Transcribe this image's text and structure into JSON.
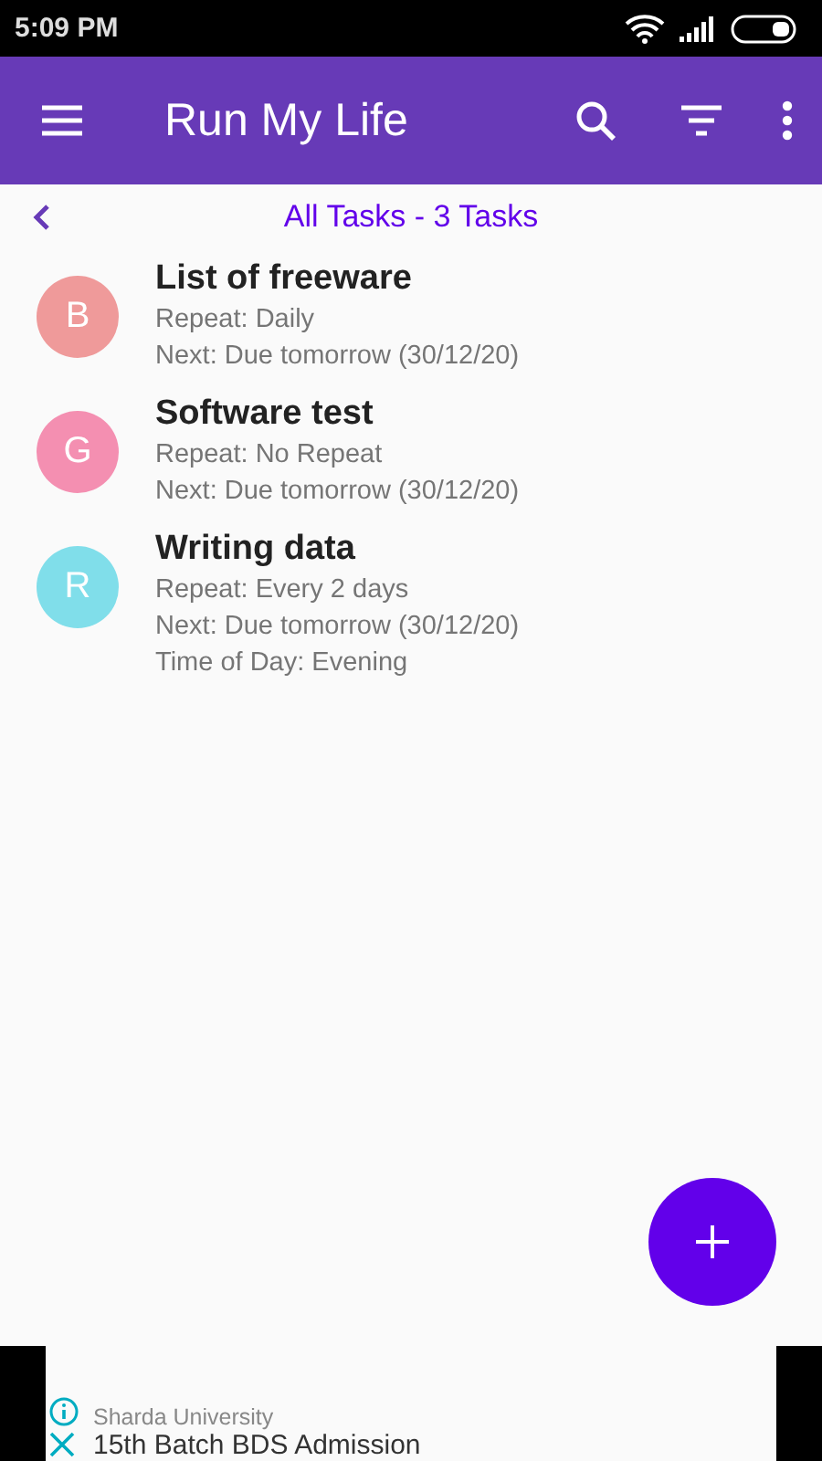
{
  "status_bar": {
    "time": "5:09 PM"
  },
  "app_bar": {
    "title": "Run My Life"
  },
  "header": {
    "title": "All Tasks - 3 Tasks"
  },
  "tasks": [
    {
      "initial": "B",
      "color": "#ef9a9a",
      "title": "List of freeware",
      "details": [
        "Repeat: Daily",
        "Next: Due tomorrow (30/12/20)"
      ]
    },
    {
      "initial": "G",
      "color": "#f48fb1",
      "title": "Software test",
      "details": [
        "Repeat: No Repeat",
        "Next: Due tomorrow (30/12/20)"
      ]
    },
    {
      "initial": "R",
      "color": "#80deea",
      "title": "Writing data",
      "details": [
        "Repeat: Every 2 days",
        "Next: Due tomorrow (30/12/20)",
        "Time of Day: Evening"
      ]
    }
  ],
  "ad": {
    "advertiser": "Sharda University",
    "headline": "15th Batch BDS Admission"
  }
}
